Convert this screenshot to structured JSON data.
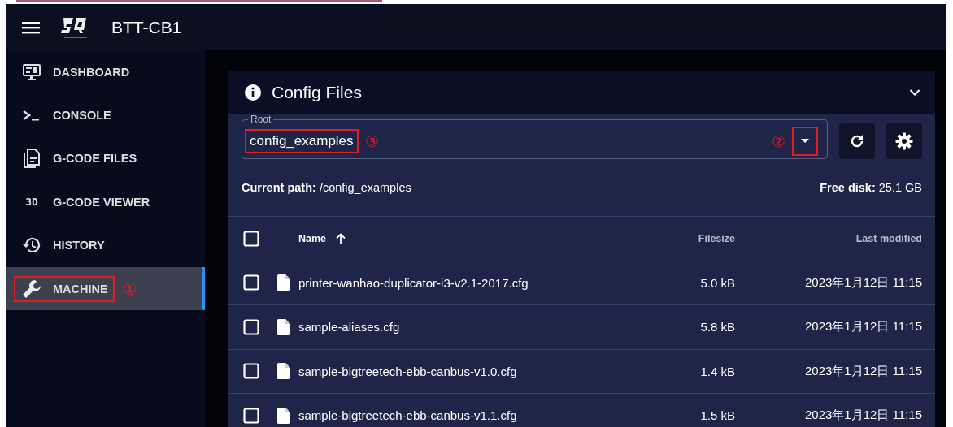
{
  "app": {
    "title": "BTT-CB1"
  },
  "nav": [
    {
      "label": "DASHBOARD",
      "selected": false
    },
    {
      "label": "CONSOLE",
      "selected": false
    },
    {
      "label": "G-CODE FILES",
      "selected": false
    },
    {
      "label": "G-CODE VIEWER",
      "icon_text": "3D",
      "selected": false
    },
    {
      "label": "HISTORY",
      "selected": false
    },
    {
      "label": "MACHINE",
      "selected": true,
      "annotation": "①"
    }
  ],
  "panel": {
    "title": "Config Files",
    "root": {
      "label": "Root",
      "value": "config_examples",
      "annotation": "③",
      "dropdown_annotation": "②"
    },
    "current_path": {
      "label": "Current path:",
      "value": "/config_examples"
    },
    "free_disk": {
      "label": "Free disk:",
      "value": "25.1 GB"
    },
    "select_all": {
      "checked": false
    },
    "columns": [
      {
        "label": "Name",
        "sorted": true
      },
      {
        "label": "Filesize",
        "sorted": false
      },
      {
        "label": "Last modified",
        "sorted": false
      }
    ],
    "rows": [
      {
        "name": "printer-wanhao-duplicator-i3-v2.1-2017.cfg",
        "size": "5.0 kB",
        "modified": "2023年1月12日 11:15",
        "checked": false
      },
      {
        "name": "sample-aliases.cfg",
        "size": "5.8 kB",
        "modified": "2023年1月12日 11:15",
        "checked": false
      },
      {
        "name": "sample-bigtreetech-ebb-canbus-v1.0.cfg",
        "size": "1.4 kB",
        "modified": "2023年1月12日 11:15",
        "checked": false
      },
      {
        "name": "sample-bigtreetech-ebb-canbus-v1.1.cfg",
        "size": "1.5 kB",
        "modified": "2023年1月12日 11:15",
        "checked": false
      }
    ]
  }
}
